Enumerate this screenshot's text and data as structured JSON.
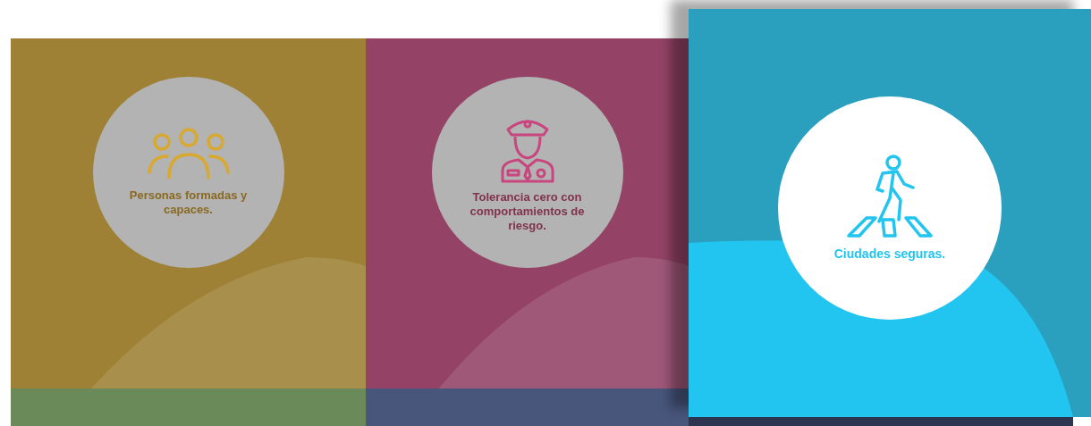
{
  "tiles": [
    {
      "kind": "people",
      "label": "Personas formadas y capaces.",
      "color": "#d8a92e",
      "selected": false
    },
    {
      "kind": "officer",
      "label": "Tolerancia cero con comportamientos de riesgo.",
      "color": "#c8457e",
      "selected": false
    },
    {
      "kind": "pedestrian",
      "label": "Ciudades seguras.",
      "color": "#22c4f0",
      "selected": true
    }
  ],
  "next_row": [
    {
      "color": "#6a8a5a"
    },
    {
      "color": "#48567c"
    },
    {
      "color": "#2e3550"
    }
  ]
}
